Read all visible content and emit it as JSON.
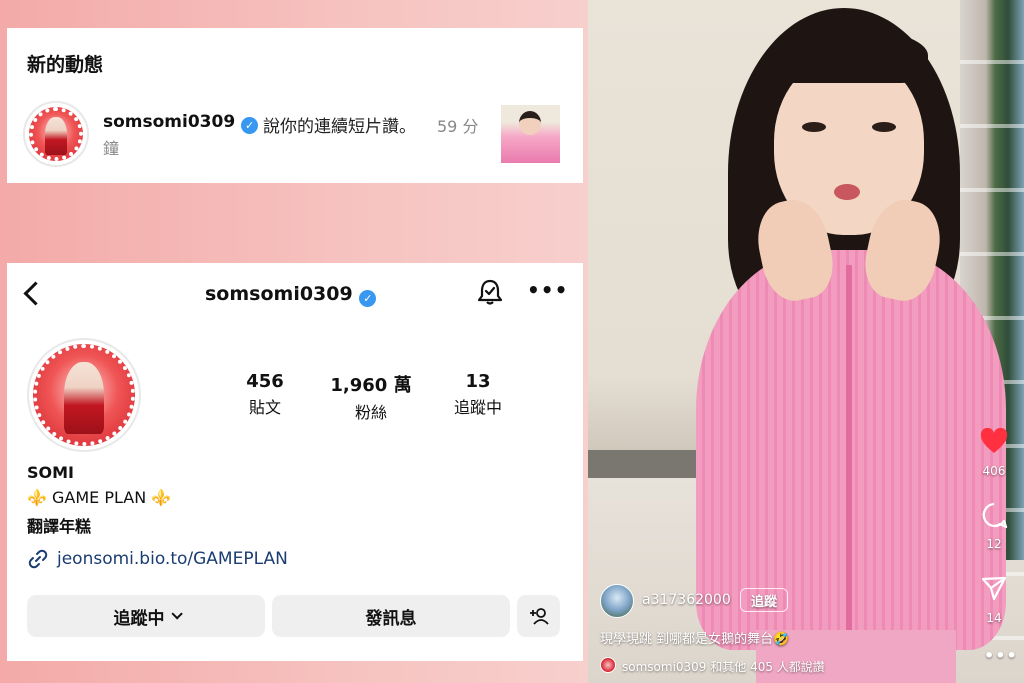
{
  "notification": {
    "title": "新的動態",
    "username": "somsomi0309",
    "message": "說你的連續短片讚。",
    "time_part1": "59 分",
    "time_part2": "鐘"
  },
  "profile": {
    "username": "somsomi0309",
    "stats": [
      {
        "value": "456",
        "label": "貼文"
      },
      {
        "value": "1,960 萬",
        "label": "粉絲"
      },
      {
        "value": "13",
        "label": "追蹤中"
      }
    ],
    "bio_name": "SOMI",
    "bio_line1": "GAME PLAN",
    "bio_fleur": "⚜️",
    "bio_line2": "翻譯年糕",
    "link": "jeonsomi.bio.to/GAMEPLAN",
    "buttons": {
      "following": "追蹤中",
      "message": "發訊息"
    }
  },
  "reel": {
    "like_count": "406",
    "comment_count": "12",
    "share_count": "14",
    "username": "a317362000",
    "follow_label": "追蹤",
    "caption": "現學現跳 到哪都是女鵝的舞台🤣",
    "liked_by": "somsomi0309 和其他 405 人都說讚"
  },
  "colors": {
    "verified": "#3897f0",
    "link": "#1b3d72",
    "like": "#ff3040",
    "button_bg": "#efefef"
  }
}
